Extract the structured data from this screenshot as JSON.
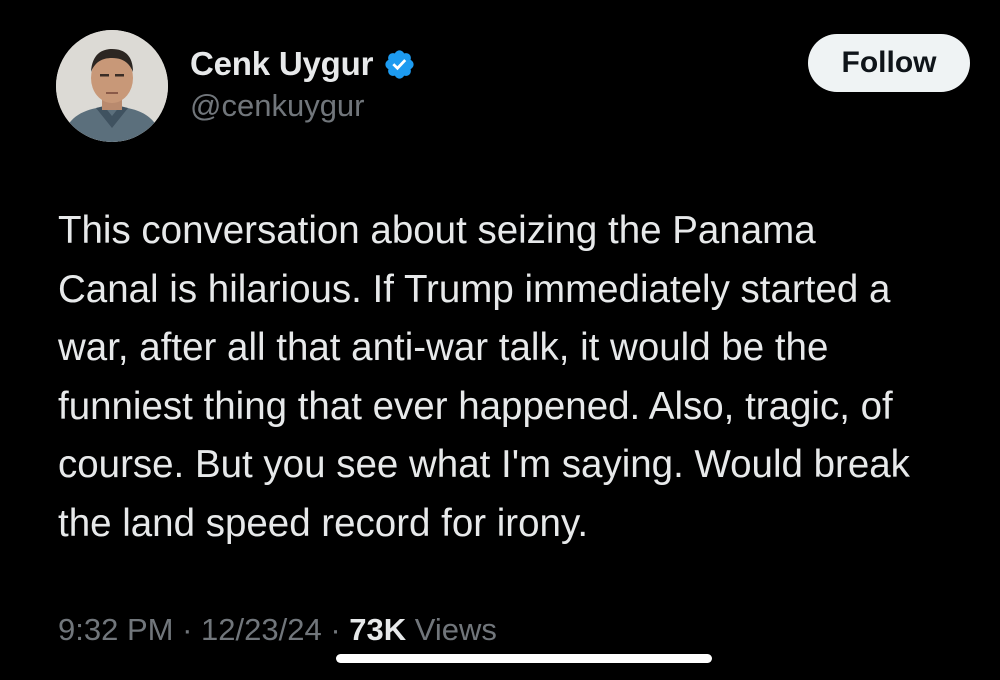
{
  "author": {
    "display_name": "Cenk Uygur",
    "handle": "@cenkuygur",
    "verified": true,
    "avatar_icon": "profile-photo"
  },
  "follow_button": {
    "label": "Follow"
  },
  "tweet": {
    "text": "This conversation about seizing the Panama\nCanal is hilarious. If Trump immediately started a\nwar, after all that anti-war talk, it would be the\nfunniest thing that ever happened. Also, tragic, of\ncourse. But you see what I'm saying. Would break\nthe land speed record for irony."
  },
  "meta": {
    "time": "9:32 PM",
    "separator": "·",
    "date": "12/23/24",
    "views_count": "73K",
    "views_label": "Views"
  },
  "colors": {
    "background": "#000000",
    "text_primary": "#e7e9ea",
    "text_secondary": "#71767b",
    "verified_badge": "#1d9bf0",
    "follow_button_bg": "#eff3f4",
    "follow_button_text": "#0f1419"
  }
}
